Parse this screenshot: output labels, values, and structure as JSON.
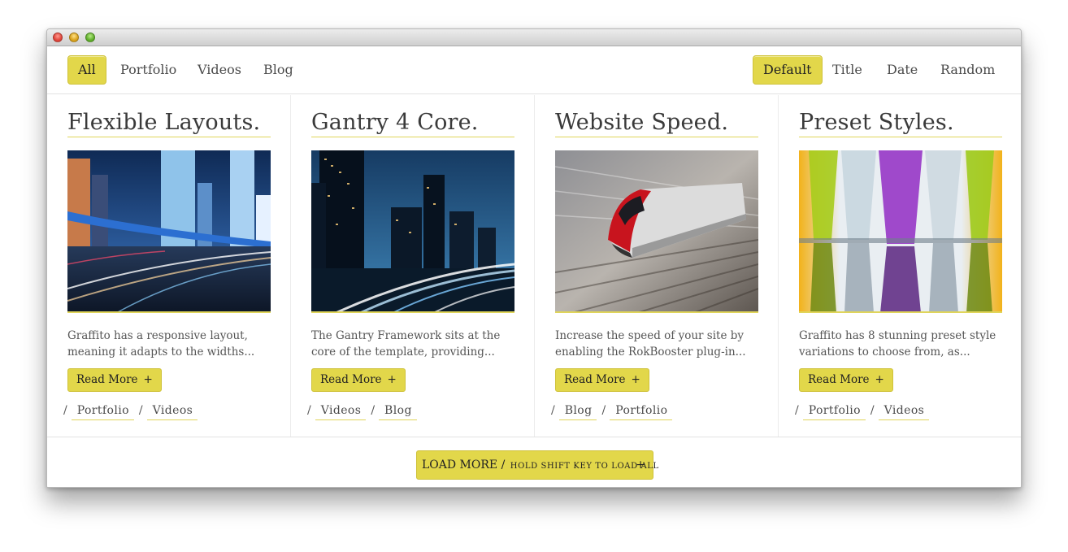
{
  "filters": {
    "categories": [
      {
        "label": "All",
        "active": true
      },
      {
        "label": "Portfolio",
        "active": false
      },
      {
        "label": "Videos",
        "active": false
      },
      {
        "label": "Blog",
        "active": false
      }
    ],
    "sort": [
      {
        "label": "Default",
        "active": true
      },
      {
        "label": "Title",
        "active": false
      },
      {
        "label": "Date",
        "active": false
      },
      {
        "label": "Random",
        "active": false
      }
    ]
  },
  "cards": [
    {
      "title": "Flexible Layouts.",
      "image": "city-highway-night-photo",
      "excerpt_1": "Graffito has a responsive layout,",
      "excerpt_2": "meaning it adapts to the widths...",
      "button": "Read More",
      "tags": [
        "Portfolio",
        "Videos"
      ]
    },
    {
      "title": "Gantry 4 Core.",
      "image": "skyscrapers-light-trails-photo",
      "excerpt_1": "The Gantry Framework sits at the",
      "excerpt_2": "core of the template, providing...",
      "button": "Read More",
      "tags": [
        "Videos",
        "Blog"
      ]
    },
    {
      "title": "Website Speed.",
      "image": "high-speed-train-photo",
      "excerpt_1": "Increase the speed of your site by",
      "excerpt_2": "enabling the RokBooster plug-in...",
      "button": "Read More",
      "tags": [
        "Blog",
        "Portfolio"
      ]
    },
    {
      "title": "Preset Styles.",
      "image": "colored-glasses-photo",
      "excerpt_1": "Graffito has 8 stunning preset style",
      "excerpt_2": "variations to choose from, as...",
      "button": "Read More",
      "tags": [
        "Portfolio",
        "Videos"
      ]
    }
  ],
  "plus_glyph": "+",
  "tag_separator": "/",
  "load_more": {
    "label": "LOAD MORE /",
    "hint": "HOLD SHIFT KEY TO LOAD ALL"
  },
  "colors": {
    "accent": "#e2d74a",
    "accent_border": "#cfc23a",
    "text": "#3a3a3a",
    "divider": "#e2e2e2"
  }
}
